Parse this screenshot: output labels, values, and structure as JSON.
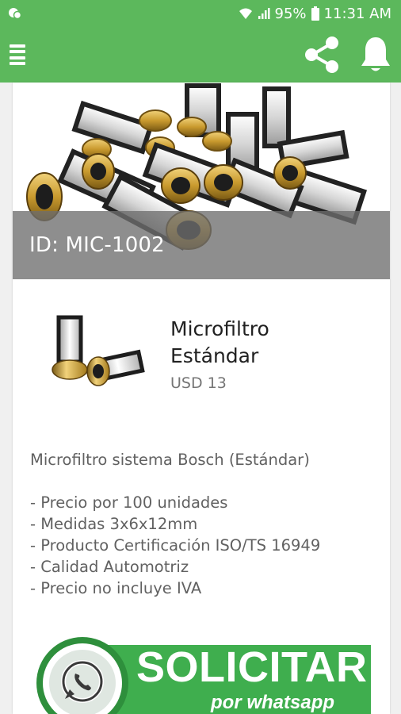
{
  "status_bar": {
    "battery": "95%",
    "time": "11:31 AM"
  },
  "app_bar": {
    "menu_icon": "hamburger-icon",
    "share_icon": "share-icon",
    "notification_icon": "bell-icon"
  },
  "product": {
    "id_label": "ID: MIC-1002",
    "title_line1": "Microfiltro",
    "title_line2": "Estándar",
    "price": "USD 13",
    "description": "Microfiltro sistema Bosch (Estándar)",
    "features": [
      "- Precio por 100 unidades",
      "- Medidas 3x6x12mm",
      "- Producto Certificación ISO/TS 16949",
      "- Calidad Automotriz",
      "- Precio no incluye IVA"
    ]
  },
  "cta": {
    "label": "SOLICITAR",
    "sublabel": "por whatsapp"
  },
  "colors": {
    "primary": "#5cb85c",
    "whatsapp_green": "#3fae4e",
    "gold": "#c99a2e"
  }
}
